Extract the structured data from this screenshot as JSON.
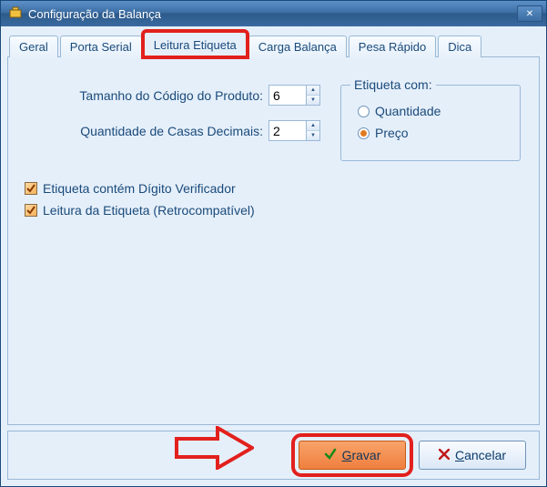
{
  "window": {
    "title": "Configuração da Balança"
  },
  "tabs": {
    "items": [
      {
        "label": "Geral"
      },
      {
        "label": "Porta Serial"
      },
      {
        "label": "Leitura Etiqueta"
      },
      {
        "label": "Carga Balança"
      },
      {
        "label": "Pesa Rápido"
      },
      {
        "label": "Dica"
      }
    ],
    "active_index": 2,
    "highlight_index": 2
  },
  "fields": {
    "tamanho_codigo": {
      "label": "Tamanho do Código do Produto:",
      "value": "6"
    },
    "casas_decimais": {
      "label": "Quantidade de Casas Decimais:",
      "value": "2"
    }
  },
  "etiqueta_group": {
    "title": "Etiqueta com:",
    "options": [
      {
        "label": "Quantidade",
        "checked": false
      },
      {
        "label": "Preço",
        "checked": true
      }
    ]
  },
  "checks": {
    "digito_verificador": {
      "label": "Etiqueta contém Dígito Verificador",
      "checked": true
    },
    "retrocompativel": {
      "label": "Leitura da Etiqueta (Retrocompatível)",
      "checked": true
    }
  },
  "buttons": {
    "gravar": "Gravar",
    "cancelar": "Cancelar"
  },
  "colors": {
    "annotation": "#e2201d"
  }
}
